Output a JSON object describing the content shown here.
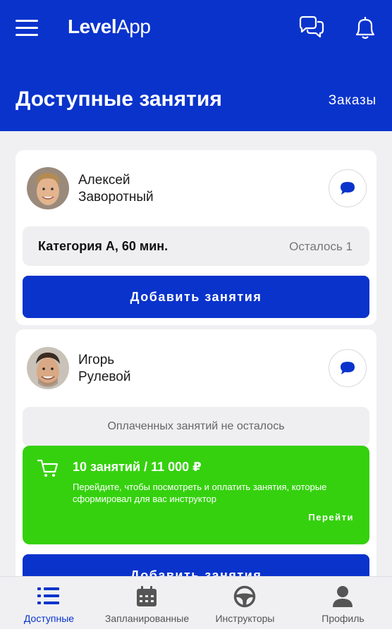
{
  "header": {
    "logo_level": "Level",
    "logo_app": "App",
    "title": "Доступные занятия",
    "orders_link": "Заказы"
  },
  "cards": [
    {
      "first_name": "Алексей",
      "last_name": "Заворотный",
      "category": "Категория А, 60 мин.",
      "remaining": "Осталось 1",
      "button": "Добавить занятия"
    },
    {
      "first_name": "Игорь",
      "last_name": "Рулевой",
      "no_lessons": "Оплаченных занятий не осталось",
      "promo_title": "10 занятий / 11 000 ₽",
      "promo_text": "Перейдите, чтобы посмотреть и оплатить занятия, которые сформировал для вас инструктор",
      "promo_link": "Перейти",
      "button": "Добавить занятия"
    }
  ],
  "tabs": [
    {
      "label": "Доступные",
      "icon": "list-icon",
      "active": true
    },
    {
      "label": "Запланированные",
      "icon": "calendar-icon",
      "active": false
    },
    {
      "label": "Инструкторы",
      "icon": "steering-wheel-icon",
      "active": false
    },
    {
      "label": "Профиль",
      "icon": "person-icon",
      "active": false
    }
  ],
  "colors": {
    "primary": "#0a33cc",
    "accent_green": "#35d10e",
    "logo_green": "#3ddc1c"
  }
}
